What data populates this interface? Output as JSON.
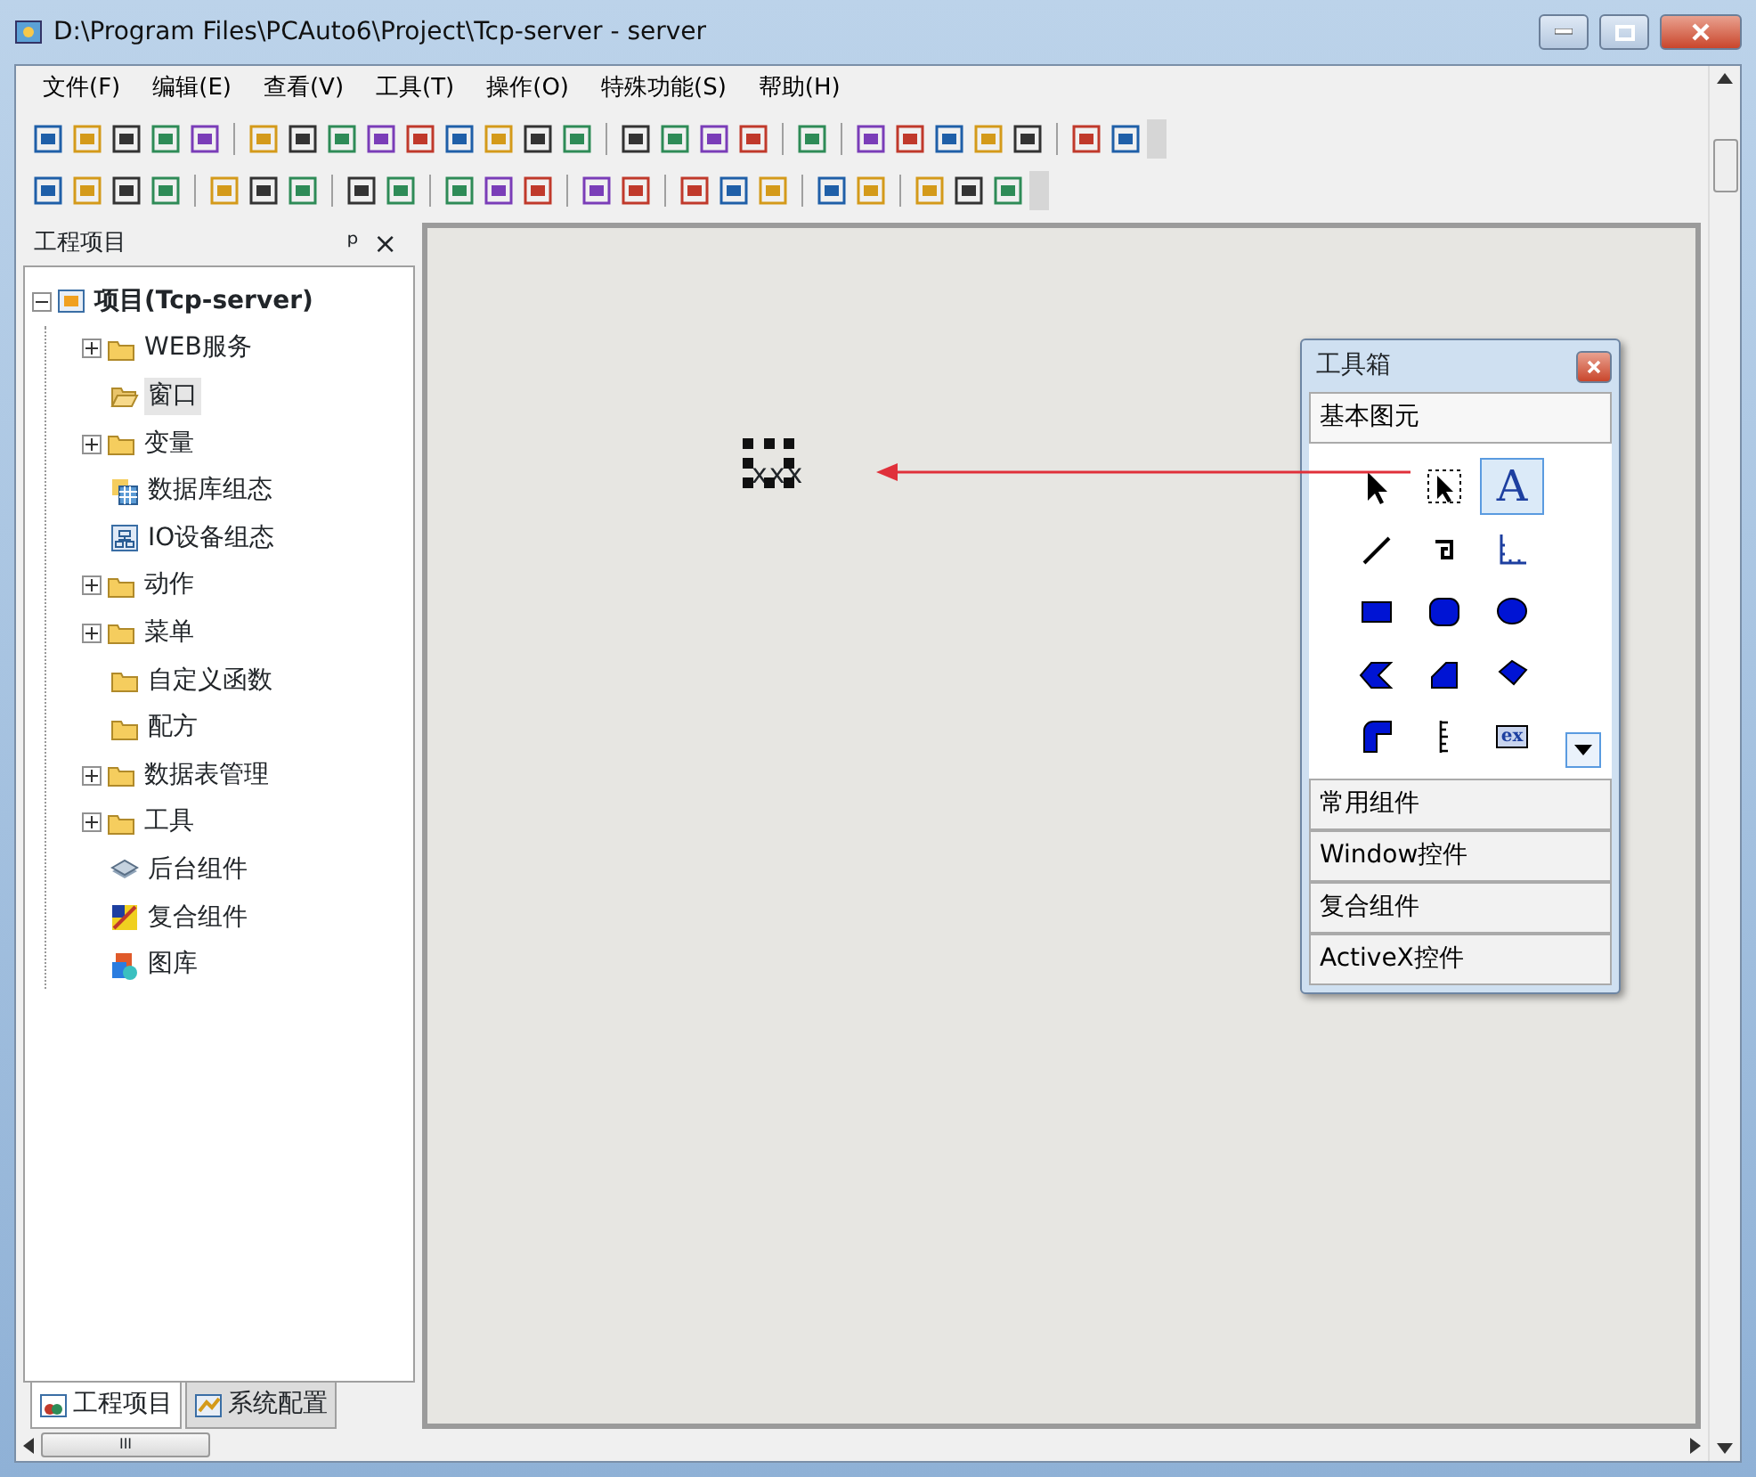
{
  "window": {
    "title": "D:\\Program Files\\PCAuto6\\Project\\Tcp-server - server"
  },
  "menu": [
    "文件(F)",
    "编辑(E)",
    "查看(V)",
    "工具(T)",
    "操作(O)",
    "特殊功能(S)",
    "帮助(H)"
  ],
  "project_panel": {
    "title": "工程项目",
    "pin": "ᵖ",
    "close": "×",
    "tree": [
      {
        "label": "项目(Tcp-server)",
        "kind": "project",
        "expanded": true,
        "selected": false,
        "children": [
          {
            "label": "WEB服务",
            "kind": "folder",
            "expanded": false,
            "selected": false
          },
          {
            "label": "窗口",
            "kind": "open-folder",
            "selected": true
          },
          {
            "label": "变量",
            "kind": "folder",
            "expanded": false,
            "selected": false
          },
          {
            "label": "数据库组态",
            "kind": "database",
            "selected": false
          },
          {
            "label": "IO设备组态",
            "kind": "device",
            "selected": false
          },
          {
            "label": "动作",
            "kind": "folder",
            "expanded": false,
            "selected": false
          },
          {
            "label": "菜单",
            "kind": "folder",
            "expanded": false,
            "selected": false
          },
          {
            "label": "自定义函数",
            "kind": "folder",
            "selected": false
          },
          {
            "label": "配方",
            "kind": "folder",
            "selected": false
          },
          {
            "label": "数据表管理",
            "kind": "folder",
            "expanded": false,
            "selected": false
          },
          {
            "label": "工具",
            "kind": "folder",
            "expanded": false,
            "selected": false
          },
          {
            "label": "后台组件",
            "kind": "layers",
            "selected": false
          },
          {
            "label": "复合组件",
            "kind": "composite",
            "selected": false
          },
          {
            "label": "图库",
            "kind": "gallery",
            "selected": false
          }
        ]
      }
    ],
    "tabs": [
      {
        "label": "工程项目",
        "selected": true
      },
      {
        "label": "系统配置",
        "selected": false
      }
    ]
  },
  "canvas": {
    "text_object": "xxx"
  },
  "toolbox": {
    "title": "工具箱",
    "sections": [
      {
        "label": "基本图元",
        "tools": [
          {
            "kind": "pointer",
            "selected": false
          },
          {
            "kind": "select-pointer",
            "selected": false
          },
          {
            "kind": "text",
            "label": "A",
            "selected": true
          },
          {
            "kind": "line",
            "selected": false
          },
          {
            "kind": "polyline",
            "selected": false
          },
          {
            "kind": "axis",
            "selected": false
          },
          {
            "kind": "rect",
            "selected": false
          },
          {
            "kind": "round-rect",
            "selected": false
          },
          {
            "kind": "ellipse",
            "selected": false
          },
          {
            "kind": "chord",
            "selected": false
          },
          {
            "kind": "pie",
            "selected": false
          },
          {
            "kind": "polygon",
            "selected": false
          },
          {
            "kind": "pipe",
            "selected": false
          },
          {
            "kind": "scale",
            "selected": false
          },
          {
            "kind": "ex",
            "label": "ex",
            "selected": false
          }
        ]
      },
      {
        "label": "常用组件"
      },
      {
        "label": "Window控件"
      },
      {
        "label": "复合组件"
      },
      {
        "label": "ActiveX控件"
      }
    ]
  },
  "scrollbar": {
    "grip": "III"
  }
}
